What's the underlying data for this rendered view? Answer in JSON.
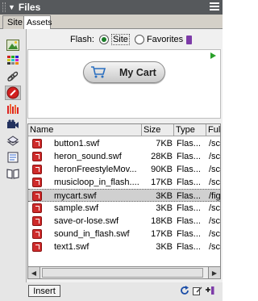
{
  "panel": {
    "title": "Files",
    "tabs": [
      {
        "label": "Site",
        "active": false
      },
      {
        "label": "Assets",
        "active": true
      }
    ]
  },
  "asset_categories": [
    {
      "icon": "images-icon"
    },
    {
      "icon": "colors-icon"
    },
    {
      "icon": "urls-icon"
    },
    {
      "icon": "flash-icon",
      "selected": true
    },
    {
      "icon": "shockwave-icon"
    },
    {
      "icon": "movies-icon"
    },
    {
      "icon": "scripts-icon"
    },
    {
      "icon": "templates-icon"
    },
    {
      "icon": "library-icon"
    }
  ],
  "flash_filter": {
    "label": "Flash:",
    "options": [
      {
        "label": "Site",
        "selected": true
      },
      {
        "label": "Favorites",
        "selected": false
      }
    ]
  },
  "preview": {
    "button_label": "My Cart"
  },
  "table": {
    "columns": [
      "Name",
      "Size",
      "Type",
      "Ful"
    ],
    "rows": [
      {
        "name": "button1.swf",
        "size": "7KB",
        "type": "Flas...",
        "full": "/sc"
      },
      {
        "name": "heron_sound.swf",
        "size": "28KB",
        "type": "Flas...",
        "full": "/sc"
      },
      {
        "name": "heronFreestyleMov...",
        "size": "90KB",
        "type": "Flas...",
        "full": "/sc"
      },
      {
        "name": "musicloop_in_flash....",
        "size": "17KB",
        "type": "Flas...",
        "full": "/sc"
      },
      {
        "name": "mycart.swf",
        "size": "3KB",
        "type": "Flas...",
        "full": "/fig",
        "selected": true
      },
      {
        "name": "sample.swf",
        "size": "3KB",
        "type": "Flas...",
        "full": "/sc"
      },
      {
        "name": "save-or-lose.swf",
        "size": "18KB",
        "type": "Flas...",
        "full": "/sc"
      },
      {
        "name": "sound_in_flash.swf",
        "size": "17KB",
        "type": "Flas...",
        "full": "/sc"
      },
      {
        "name": "text1.swf",
        "size": "3KB",
        "type": "Flas...",
        "full": "/sc"
      }
    ]
  },
  "footer": {
    "insert_label": "Insert"
  },
  "colors": {
    "titlebar": "#56595c",
    "radio_selected": "#197c28",
    "flash_file": "#ce2b2b",
    "selected_row": "#d0d0d0"
  }
}
